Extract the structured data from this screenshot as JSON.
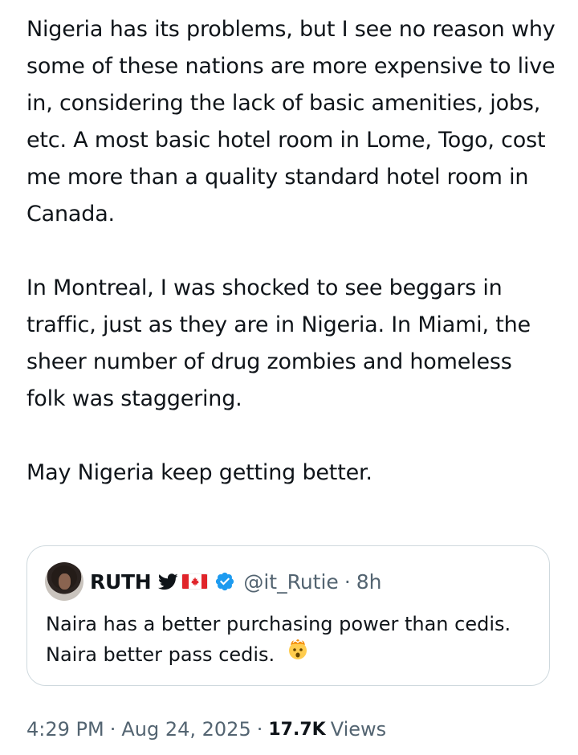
{
  "tweet": {
    "paragraphs": [
      "Nigeria has its problems, but I see no reason why some of these nations are more expensive to live in, considering the lack of basic amenities, jobs, etc. A most basic hotel room in Lome, Togo, cost me more than a quality standard hotel room in Canada.",
      "In Montreal, I was shocked to see beggars in traffic, just as they are in Nigeria. In Miami, the sheer number of drug zombies and homeless folk was staggering.",
      "May Nigeria keep getting better."
    ]
  },
  "quote": {
    "name": "RUTH",
    "handle": "@it_Rutie",
    "separator": "·",
    "age": "8h",
    "text": "Naira has a better purchasing power than cedis. Naira better pass cedis.",
    "icons": [
      "twitter-bird-icon",
      "canada-flag-icon",
      "verified-icon",
      "exploding-head-emoji"
    ],
    "verified_color": "#1d9bf0"
  },
  "meta": {
    "time": "4:29 PM",
    "separator": "·",
    "date": "Aug 24, 2025",
    "views_count": "17.7K",
    "views_label": "Views"
  },
  "colors": {
    "text": "#0f1419",
    "secondary": "#536471",
    "border": "#cfd9de"
  }
}
